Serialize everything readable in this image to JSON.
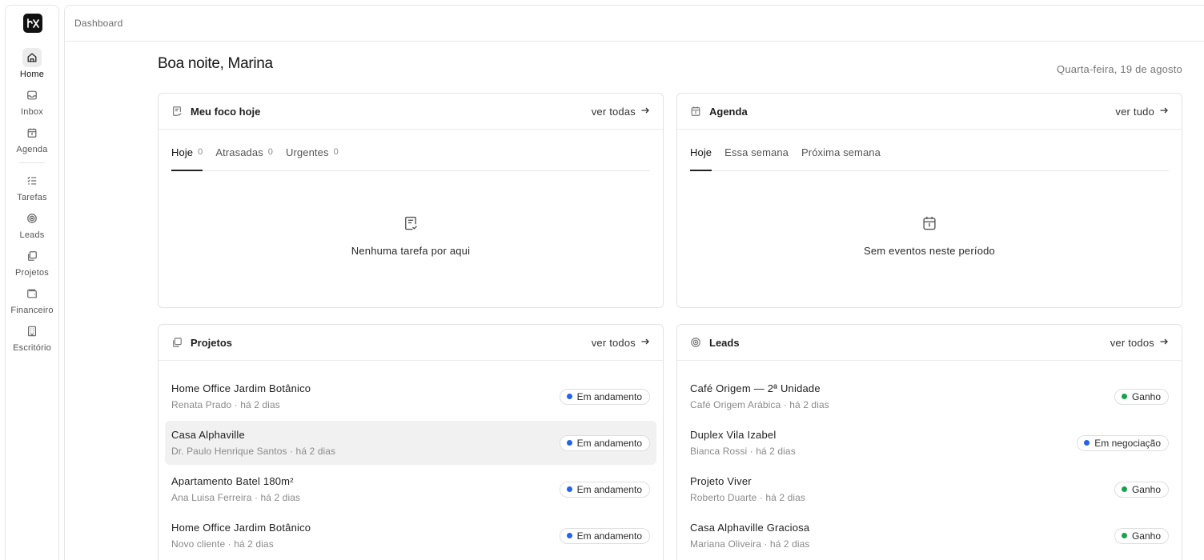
{
  "sidebar": {
    "logo_alt": "logo",
    "items": [
      {
        "label": "Home",
        "icon": "home-icon",
        "active": true
      },
      {
        "label": "Inbox",
        "icon": "inbox-icon"
      },
      {
        "label": "Agenda",
        "icon": "calendar-icon"
      },
      {
        "label": "Tarefas",
        "icon": "checklist-icon"
      },
      {
        "label": "Leads",
        "icon": "target-icon"
      },
      {
        "label": "Projetos",
        "icon": "folders-icon"
      },
      {
        "label": "Financeiro",
        "icon": "wallet-icon"
      },
      {
        "label": "Escritório",
        "icon": "building-icon"
      }
    ]
  },
  "header": {
    "breadcrumb": "Dashboard"
  },
  "greeting": "Boa noite, Marina",
  "date": "Quarta-feira, 19 de agosto",
  "focus": {
    "title": "Meu foco hoje",
    "link": "ver todas",
    "tabs": [
      {
        "label": "Hoje",
        "count": "0"
      },
      {
        "label": "Atrasadas",
        "count": "0"
      },
      {
        "label": "Urgentes",
        "count": "0"
      }
    ],
    "empty": "Nenhuma tarefa por aqui"
  },
  "agenda": {
    "title": "Agenda",
    "link": "ver tudo",
    "tabs": [
      {
        "label": "Hoje"
      },
      {
        "label": "Essa semana"
      },
      {
        "label": "Próxima semana"
      }
    ],
    "empty": "Sem eventos neste período"
  },
  "projects": {
    "title": "Projetos",
    "link": "ver todos",
    "items": [
      {
        "title": "Home Office Jardim Botânico",
        "sub": "Renata Prado · há 2 dias",
        "status": "Em andamento"
      },
      {
        "title": "Casa Alphaville",
        "sub": "Dr. Paulo Henrique Santos · há 2 dias",
        "status": "Em andamento"
      },
      {
        "title": "Apartamento Batel 180m²",
        "sub": "Ana Luisa Ferreira · há 2 dias",
        "status": "Em andamento"
      },
      {
        "title": "Home Office Jardim Botânico",
        "sub": "Novo cliente · há 2 dias",
        "status": "Em andamento"
      }
    ]
  },
  "leads": {
    "title": "Leads",
    "link": "ver todos",
    "items": [
      {
        "title": "Café Origem — 2ª Unidade",
        "sub": "Café Origem Arábica · há 2 dias",
        "status": "Ganho"
      },
      {
        "title": "Duplex Vila Izabel",
        "sub": "Bianca Rossi · há 2 dias",
        "status": "Em negociação"
      },
      {
        "title": "Projeto Viver",
        "sub": "Roberto Duarte · há 2 dias",
        "status": "Ganho"
      },
      {
        "title": "Casa Alphaville Graciosa",
        "sub": "Mariana Oliveira · há 2 dias",
        "status": "Ganho"
      }
    ]
  },
  "colors": {
    "status_blue": "#2563eb",
    "status_green": "#16a34a"
  }
}
